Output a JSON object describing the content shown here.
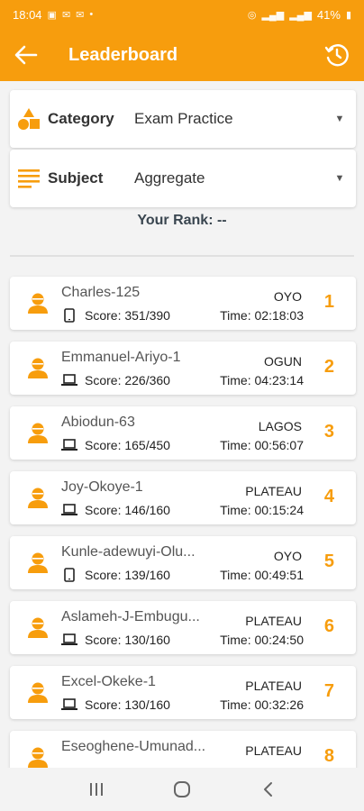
{
  "status": {
    "time": "18:04",
    "battery": "41%"
  },
  "appbar": {
    "title": "Leaderboard",
    "back_icon": "arrow-left-icon",
    "history_icon": "history-clock-icon"
  },
  "filters": {
    "category_label": "Category",
    "category_value": "Exam Practice",
    "subject_label": "Subject",
    "subject_value": "Aggregate"
  },
  "rank_text": "Your Rank: --",
  "colors": {
    "accent": "#f79d0d"
  },
  "entries": [
    {
      "name": "Charles-125",
      "state": "OYO",
      "score": "Score: 351/390",
      "time": "Time: 02:18:03",
      "position": "1",
      "device": "phone"
    },
    {
      "name": "Emmanuel-Ariyo-1",
      "state": "OGUN",
      "score": "Score: 226/360",
      "time": "Time: 04:23:14",
      "position": "2",
      "device": "laptop"
    },
    {
      "name": "Abiodun-63",
      "state": "LAGOS",
      "score": "Score: 165/450",
      "time": "Time: 00:56:07",
      "position": "3",
      "device": "laptop"
    },
    {
      "name": "Joy-Okoye-1",
      "state": "PLATEAU",
      "score": "Score: 146/160",
      "time": "Time: 00:15:24",
      "position": "4",
      "device": "laptop"
    },
    {
      "name": "Kunle-adewuyi-Olu...",
      "state": "OYO",
      "score": "Score: 139/160",
      "time": "Time: 00:49:51",
      "position": "5",
      "device": "phone"
    },
    {
      "name": "Aslameh-J-Embugu...",
      "state": "PLATEAU",
      "score": "Score: 130/160",
      "time": "Time: 00:24:50",
      "position": "6",
      "device": "laptop"
    },
    {
      "name": "Excel-Okeke-1",
      "state": "PLATEAU",
      "score": "Score: 130/160",
      "time": "Time: 00:32:26",
      "position": "7",
      "device": "laptop"
    },
    {
      "name": "Eseoghene-Umunad...",
      "state": "PLATEAU",
      "score": "",
      "time": "",
      "position": "8",
      "device": ""
    }
  ]
}
